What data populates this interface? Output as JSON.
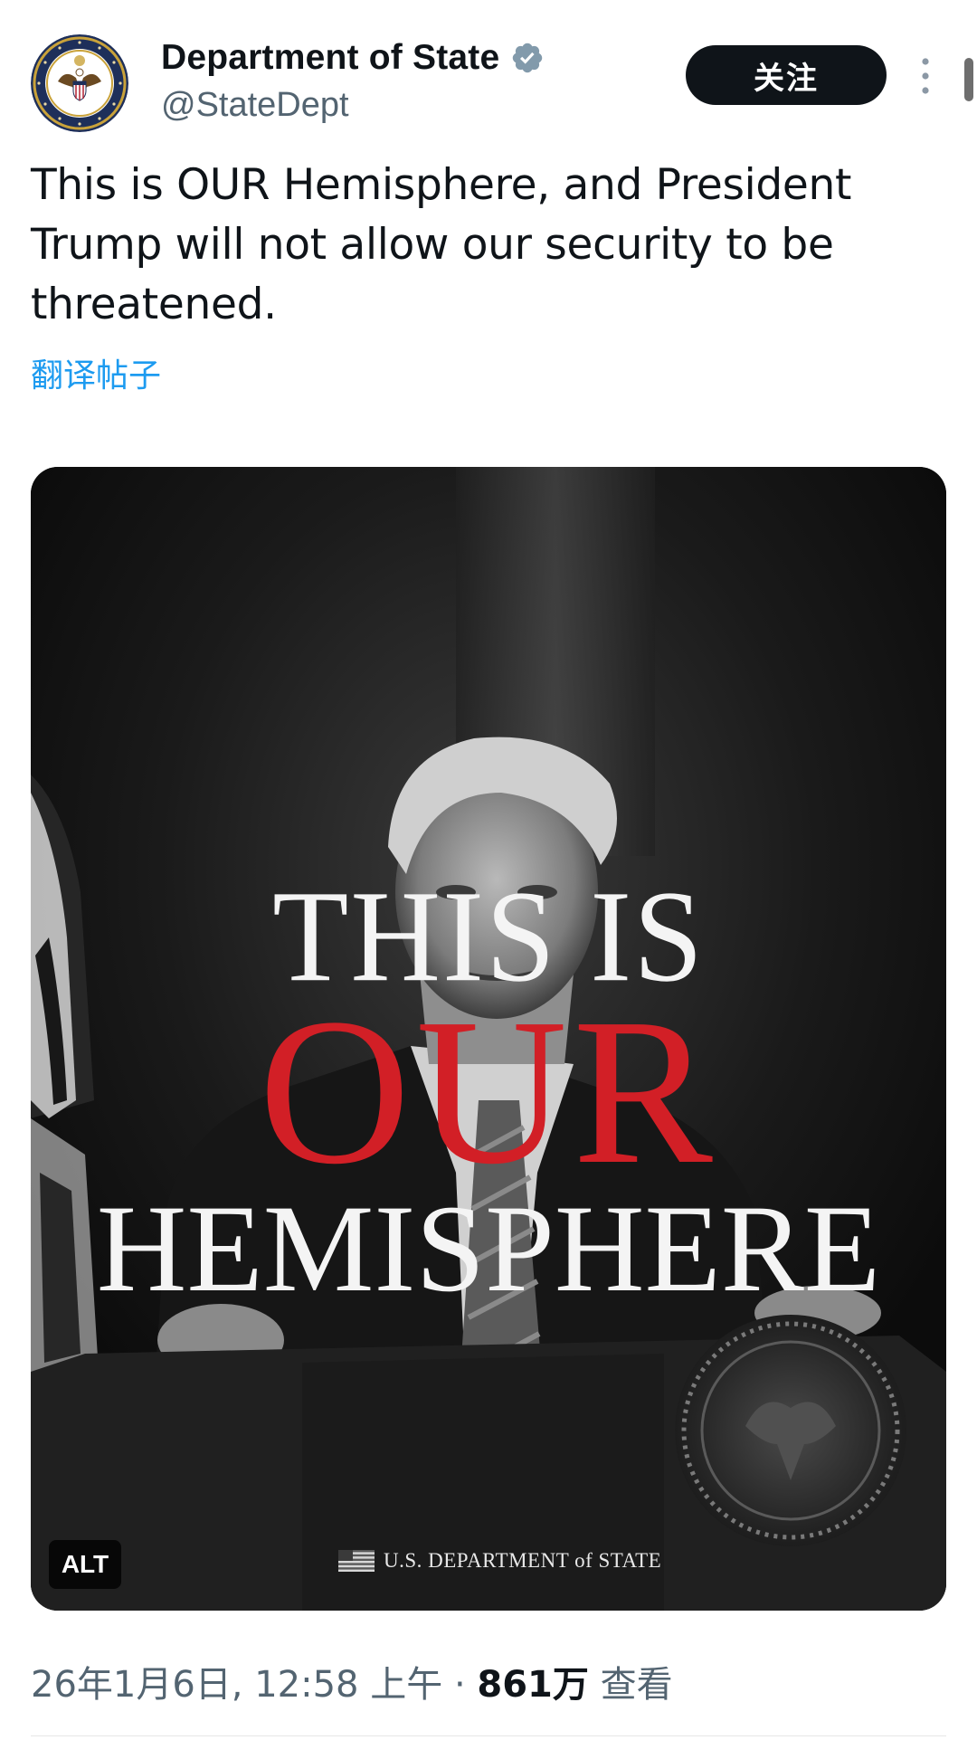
{
  "post": {
    "author": {
      "display_name": "Department of State",
      "handle": "@StateDept",
      "verified": true
    },
    "follow_label": "关注",
    "text": "This is OUR Hemisphere, and President Trump will not allow our security to be threatened.",
    "translate_label": "翻译帖子",
    "media": {
      "headline_line1": "THIS IS",
      "headline_line2": "OUR",
      "headline_line3": "HEMISPHERE",
      "watermark": "U.S. DEPARTMENT of STATE",
      "alt_badge": "ALT"
    },
    "meta": {
      "timestamp": "26年1月6日, 12:58 上午",
      "separator": "·",
      "views_count": "861万",
      "views_label": "查看"
    }
  },
  "icons": {
    "verified": "verified-badge-icon",
    "more": "more-vertical-icon",
    "avatar": "state-department-seal"
  },
  "colors": {
    "accent": "#1d9bf0",
    "headline_red": "#d21f26",
    "follow_button_bg": "#0f1419",
    "secondary_text": "#536471"
  }
}
